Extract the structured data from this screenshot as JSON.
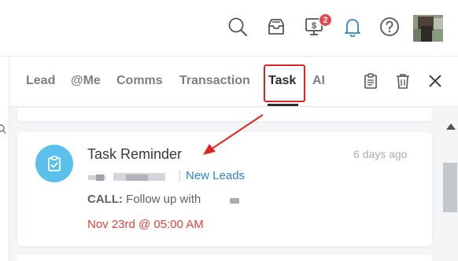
{
  "topbar": {
    "icons": [
      "search-icon",
      "inbox-icon",
      "billing-icon",
      "bell-icon",
      "help-icon"
    ],
    "billing_badge": "2",
    "accent": "#2f86c9",
    "badge_color": "#e5484d"
  },
  "tabs": {
    "items": [
      "Lead",
      "@Me",
      "Comms",
      "Transaction",
      "Task",
      "AI"
    ],
    "active": "Task",
    "actions": [
      "clipboard-icon",
      "trash-icon",
      "close-icon"
    ],
    "highlight_color": "#e02424"
  },
  "task": {
    "title": "Task Reminder",
    "time_ago": "6 days ago",
    "category_link": "New Leads",
    "call_label": "CALL:",
    "call_text": " Follow up with",
    "due": "Nov 23rd @ 05:00 AM",
    "icon": "task-checklist-icon",
    "icon_color": "#5bc0eb",
    "due_color": "#e04141"
  }
}
